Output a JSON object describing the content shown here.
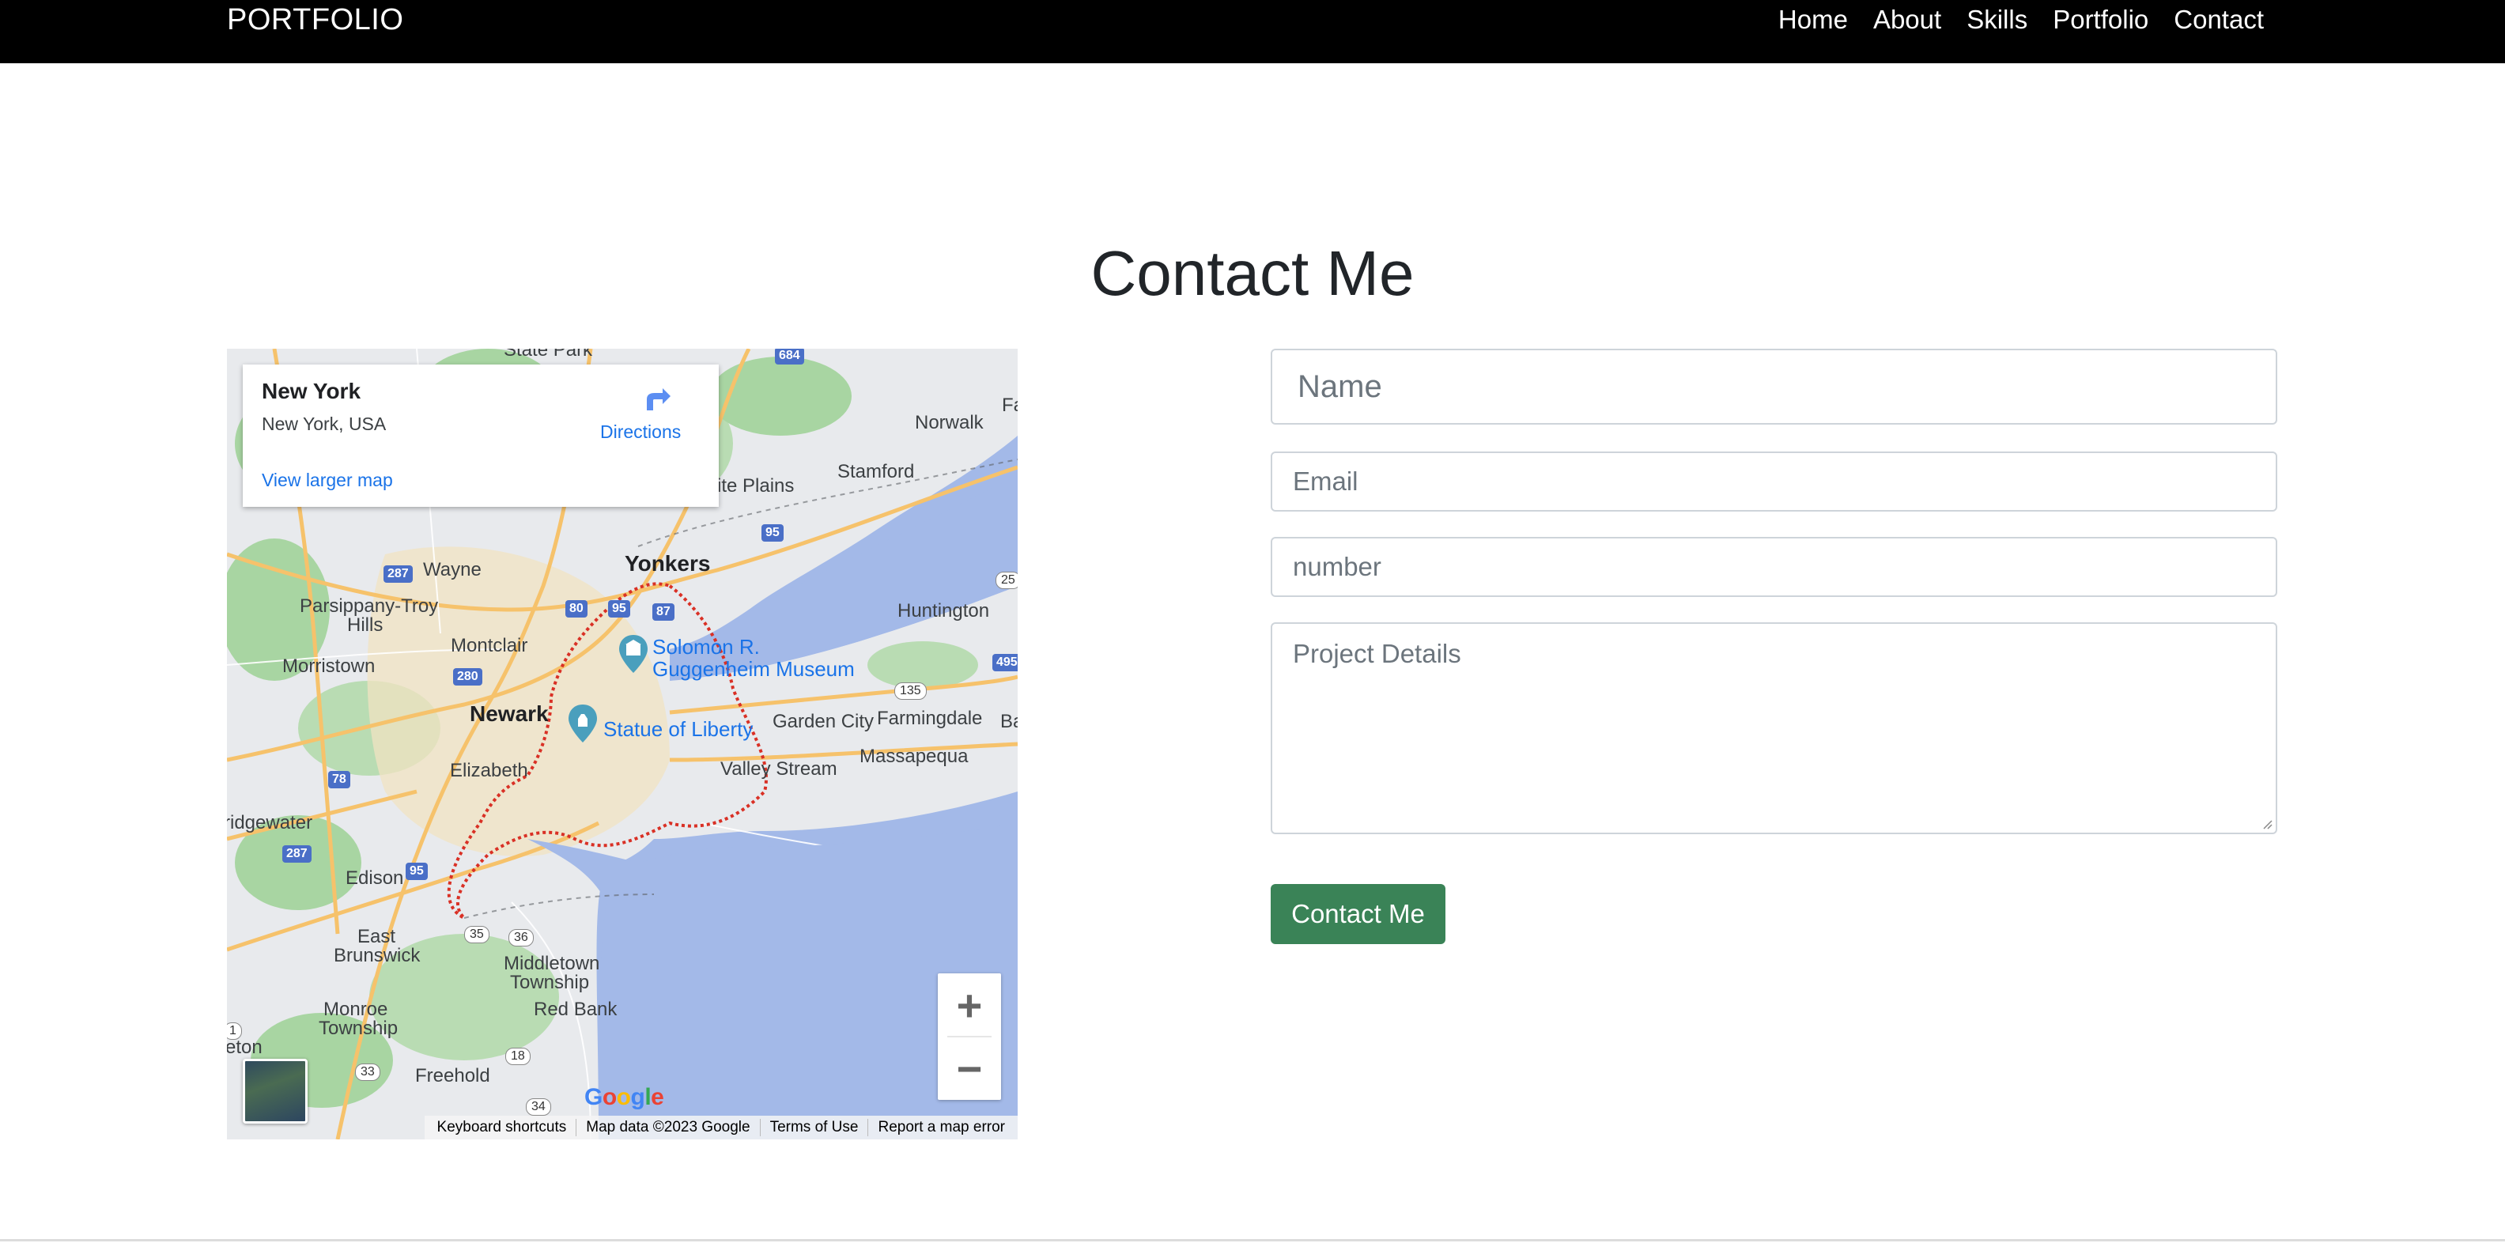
{
  "navbar": {
    "brand": "PORTFOLIO",
    "links": [
      {
        "label": "Home"
      },
      {
        "label": "About"
      },
      {
        "label": "Skills"
      },
      {
        "label": "Portfolio"
      },
      {
        "label": "Contact"
      }
    ]
  },
  "page": {
    "title": "Contact Me"
  },
  "map": {
    "info_card": {
      "title": "New York",
      "subtitle": "New York, USA",
      "directions_label": "Directions",
      "larger_map_link": "View larger map"
    },
    "labels": {
      "state_park": "State Park",
      "norwalk": "Norwalk",
      "fa": "Fa",
      "white_plains": "ite Plains",
      "stamford": "Stamford",
      "wayne": "Wayne",
      "yonkers": "Yonkers",
      "parsippany": "Parsippany-Troy",
      "hills": "Hills",
      "huntington": "Huntington",
      "montclair": "Montclair",
      "morristown": "Morristown",
      "solomon": "Solomon R.",
      "guggenheim": "Guggenheim Museum",
      "newark": "Newark",
      "statue": "Statue of Liberty",
      "garden_city": "Garden City",
      "farmingdale": "Farmingdale",
      "elizabeth": "Elizabeth",
      "massapequa": "Massapequa",
      "valley_stream": "Valley Stream",
      "bridgewater": "ridgewater",
      "edison": "Edison",
      "east": "East",
      "brunswick": "Brunswick",
      "middletown": "Middletown",
      "township": "Township",
      "red_bank": "Red Bank",
      "monroe": "Monroe",
      "monroe_twp": "Township",
      "freehold": "Freehold",
      "ba": "Ba",
      "eton": "eton"
    },
    "shields": {
      "s684": "684",
      "s287a": "287",
      "s80": "80",
      "s95a": "95",
      "s87": "87",
      "s95b": "95",
      "s280": "280",
      "s78": "78",
      "s287b": "287",
      "s95c": "95",
      "s135": "135",
      "s25": "25",
      "s495": "495",
      "s35": "35",
      "s36": "36",
      "s33": "33",
      "s18": "18",
      "s34": "34",
      "s1": "1"
    },
    "google_logo": "Google",
    "attribution": {
      "shortcuts": "Keyboard shortcuts",
      "data": "Map data ©2023 Google",
      "terms": "Terms of Use",
      "report": "Report a map error"
    },
    "zoom_in": "+",
    "zoom_out": "−",
    "colors": {
      "water": "#a3b9e8",
      "land": "#e8eaed",
      "park": "#a8d5a2",
      "highway": "#f6c26b",
      "boundary": "#d93025"
    }
  },
  "form": {
    "name_placeholder": "Name",
    "email_placeholder": "Email",
    "number_placeholder": "number",
    "details_placeholder": "Project Details",
    "submit_label": "Contact Me"
  },
  "colors": {
    "navbar_bg": "#000000",
    "submit_bg": "#3a8357",
    "link_blue": "#1a73e8"
  }
}
